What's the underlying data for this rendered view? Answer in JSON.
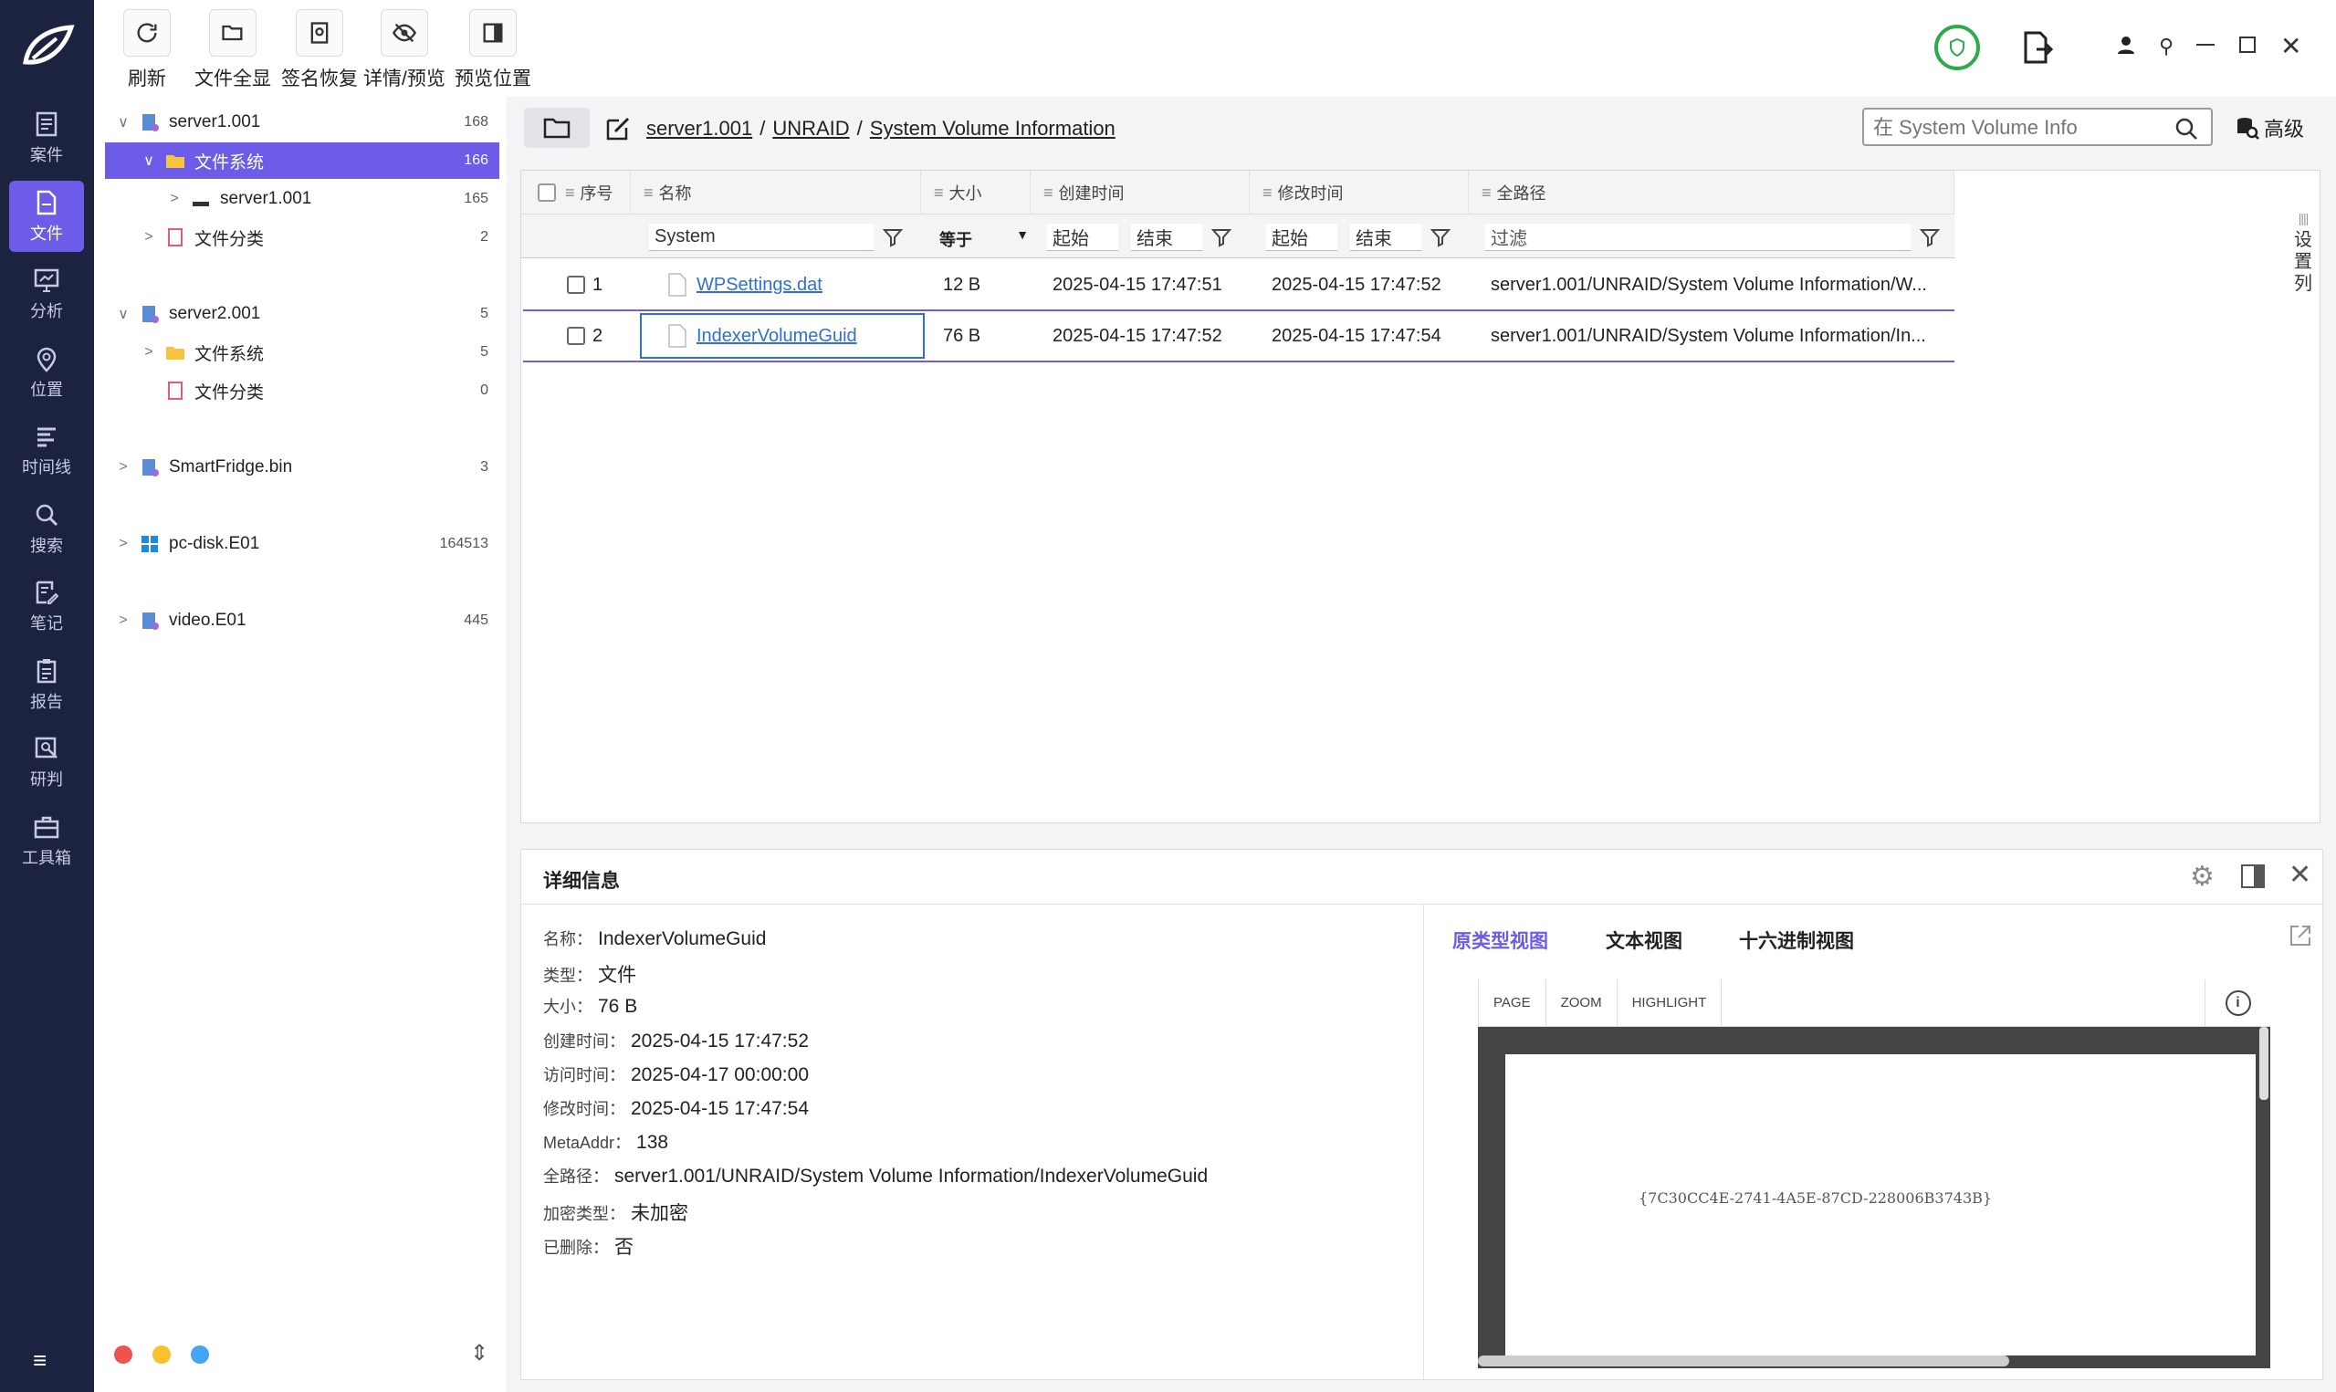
{
  "nav": {
    "items": [
      {
        "label": "案件",
        "icon": "case-icon"
      },
      {
        "label": "文件",
        "icon": "file-icon"
      },
      {
        "label": "分析",
        "icon": "analysis-icon"
      },
      {
        "label": "位置",
        "icon": "location-icon"
      },
      {
        "label": "时间线",
        "icon": "timeline-icon"
      },
      {
        "label": "搜索",
        "icon": "search-icon"
      },
      {
        "label": "笔记",
        "icon": "note-icon"
      },
      {
        "label": "报告",
        "icon": "report-icon"
      },
      {
        "label": "研判",
        "icon": "judge-icon"
      },
      {
        "label": "工具箱",
        "icon": "toolbox-icon"
      }
    ],
    "active": 1
  },
  "toolbar": {
    "buttons": [
      {
        "label": "刷新",
        "icon": "refresh-icon"
      },
      {
        "label": "文件全显",
        "icon": "folder-open-icon"
      },
      {
        "label": "签名恢复",
        "icon": "signature-icon"
      },
      {
        "label": "详情/预览",
        "icon": "eye-off-icon"
      },
      {
        "label": "预览位置",
        "icon": "panel-right-icon"
      }
    ]
  },
  "tree": [
    {
      "label": "server1.001",
      "count": "168",
      "level": 0,
      "chev": "∨",
      "icon": "disk-image-icon"
    },
    {
      "label": "文件系统",
      "count": "166",
      "level": 1,
      "chev": "∨",
      "icon": "folder-icon",
      "selected": true
    },
    {
      "label": "server1.001",
      "count": "165",
      "level": 2,
      "chev": ">",
      "icon": "drive-icon"
    },
    {
      "label": "文件分类",
      "count": "2",
      "level": 1,
      "chev": ">",
      "icon": "category-icon"
    },
    {
      "label": "server2.001",
      "count": "5",
      "level": 0,
      "chev": "∨",
      "icon": "disk-image-icon"
    },
    {
      "label": "文件系统",
      "count": "5",
      "level": 1,
      "chev": ">",
      "icon": "folder-icon"
    },
    {
      "label": "文件分类",
      "count": "0",
      "level": 1,
      "chev": "",
      "icon": "category-icon"
    },
    {
      "label": "SmartFridge.bin",
      "count": "3",
      "level": 0,
      "chev": ">",
      "icon": "disk-image-icon"
    },
    {
      "label": "pc-disk.E01",
      "count": "164513",
      "level": 0,
      "chev": ">",
      "icon": "windows-icon"
    },
    {
      "label": "video.E01",
      "count": "445",
      "level": 0,
      "chev": ">",
      "icon": "disk-image-icon"
    }
  ],
  "path": {
    "parts": [
      "server1.001",
      "UNRAID",
      "System Volume Information"
    ],
    "sep": "/"
  },
  "search": {
    "placeholder": "在 System Volume Info",
    "advanced": "高级"
  },
  "grid": {
    "headers": {
      "index": "序号",
      "name": "名称",
      "size": "大小",
      "ctime": "创建时间",
      "mtime": "修改时间",
      "path": "全路径"
    },
    "filters": {
      "name": "System",
      "size_op": "等于",
      "start": "起始",
      "end": "结束",
      "path": "过滤"
    },
    "rows": [
      {
        "index": "1",
        "name": "WPSettings.dat",
        "size": "12 B",
        "ctime": "2025-04-15 17:47:51",
        "mtime": "2025-04-15 17:47:52",
        "path": "server1.001/UNRAID/System Volume Information/W..."
      },
      {
        "index": "2",
        "name": "IndexerVolumeGuid",
        "size": "76 B",
        "ctime": "2025-04-15 17:47:52",
        "mtime": "2025-04-15 17:47:54",
        "path": "server1.001/UNRAID/System Volume Information/In..."
      }
    ],
    "side_settings": "设置列"
  },
  "details": {
    "title": "详细信息",
    "fields": [
      {
        "k": "名称：",
        "v": "IndexerVolumeGuid"
      },
      {
        "k": "类型：",
        "v": "文件"
      },
      {
        "k": "大小：",
        "v": "76 B"
      },
      {
        "k": "创建时间：",
        "v": "2025-04-15 17:47:52"
      },
      {
        "k": "访问时间：",
        "v": "2025-04-17 00:00:00"
      },
      {
        "k": "修改时间：",
        "v": "2025-04-15 17:47:54"
      },
      {
        "k": "MetaAddr：",
        "v": "138"
      },
      {
        "k": "全路径：",
        "v": "server1.001/UNRAID/System Volume Information/IndexerVolumeGuid"
      },
      {
        "k": "加密类型：",
        "v": "未加密"
      },
      {
        "k": "已删除：",
        "v": "否"
      }
    ],
    "tabs": [
      "原类型视图",
      "文本视图",
      "十六进制视图"
    ],
    "viewer_buttons": [
      "PAGE",
      "ZOOM",
      "HIGHLIGHT"
    ],
    "viewer_content": "{7C30CC4E-2741-4A5E-87CD-228006B3743B}"
  },
  "colors": {
    "accent": "#6c5ce7",
    "nav_bg": "#1b2340",
    "link": "#2f6fd6",
    "dot_red": "#ef5350",
    "dot_yellow": "#fbc02d",
    "dot_blue": "#42a5f5"
  }
}
